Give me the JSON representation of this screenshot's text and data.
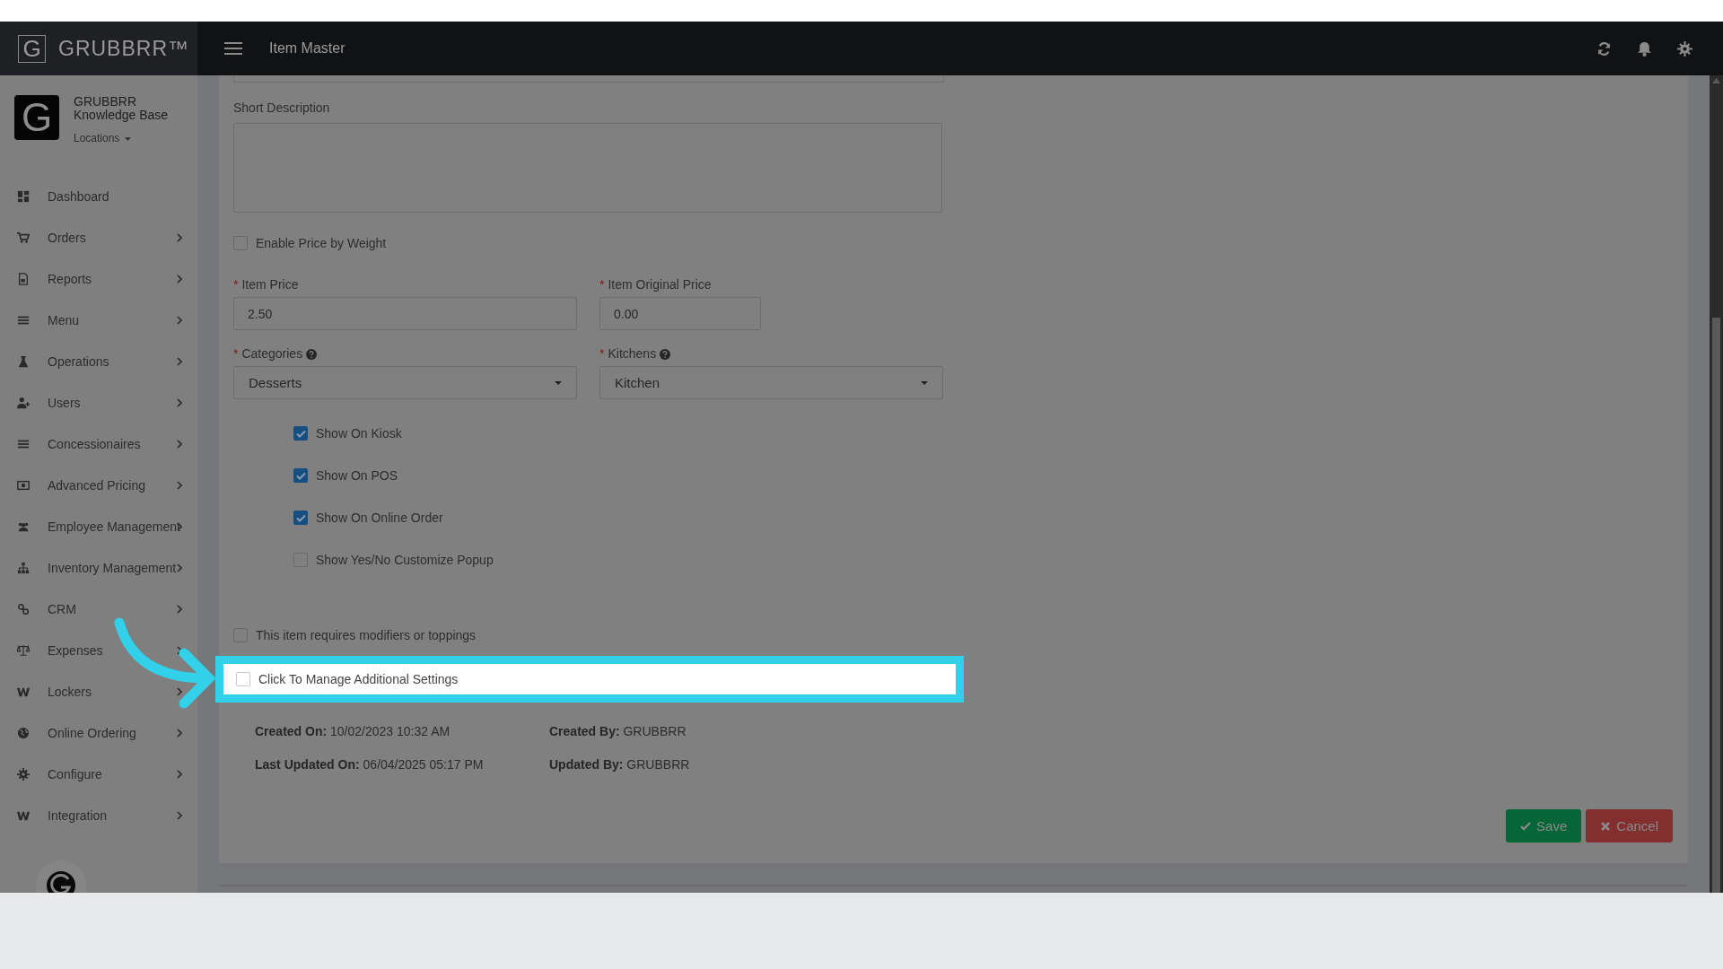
{
  "header": {
    "logo_letter": "G",
    "brand": "GRUBBRR™",
    "title": "Item Master"
  },
  "sidebar": {
    "org_logo_letter": "G",
    "org_name": "GRUBBRR",
    "org_subtitle": "Knowledge Base",
    "locations": "Locations",
    "items": [
      {
        "label": "Dashboard",
        "expandable": false
      },
      {
        "label": "Orders",
        "expandable": true
      },
      {
        "label": "Reports",
        "expandable": true
      },
      {
        "label": "Menu",
        "expandable": true
      },
      {
        "label": "Operations",
        "expandable": true
      },
      {
        "label": "Users",
        "expandable": true
      },
      {
        "label": "Concessionaires",
        "expandable": true
      },
      {
        "label": "Advanced Pricing",
        "expandable": true
      },
      {
        "label": "Employee Management",
        "expandable": true
      },
      {
        "label": "Inventory Management",
        "expandable": true
      },
      {
        "label": "CRM",
        "expandable": true
      },
      {
        "label": "Expenses",
        "expandable": true
      },
      {
        "label": "Lockers",
        "expandable": true
      },
      {
        "label": "Online Ordering",
        "expandable": true
      },
      {
        "label": "Configure",
        "expandable": true
      },
      {
        "label": "Integration",
        "expandable": true
      }
    ]
  },
  "form": {
    "short_description": {
      "label": "Short Description"
    },
    "price_by_weight": {
      "label": "Enable Price by Weight",
      "checked": false
    },
    "item_price": {
      "required_mark": "*",
      "label": "Item Price",
      "value": "2.50"
    },
    "item_original_price": {
      "required_mark": "*",
      "label": "Item Original Price",
      "value": "0.00"
    },
    "categories": {
      "required_mark": "*",
      "label": "Categories",
      "value": "Desserts"
    },
    "kitchens": {
      "required_mark": "*",
      "label": "Kitchens",
      "value": "Kitchen"
    },
    "visibility": [
      {
        "label": "Show On Kiosk",
        "checked": true
      },
      {
        "label": "Show On POS",
        "checked": true
      },
      {
        "label": "Show On Online Order",
        "checked": true
      },
      {
        "label": "Show Yes/No Customize Popup",
        "checked": false
      }
    ],
    "requires_modifiers": {
      "label": "This item requires modifiers or toppings",
      "checked": false
    },
    "additional_settings": {
      "label": "Click To Manage Additional Settings",
      "checked": false,
      "highlighted": true
    },
    "audit": [
      {
        "label": "Created On:",
        "value": "10/02/2023 10:32 AM"
      },
      {
        "label": "Created By:",
        "value": "GRUBBRR"
      },
      {
        "label": "Last Updated On:",
        "value": "06/04/2025 05:17 PM"
      },
      {
        "label": "Updated By:",
        "value": "GRUBBRR"
      }
    ],
    "buttons": [
      {
        "label": "Save",
        "kind": "save"
      },
      {
        "label": "Cancel",
        "kind": "cancel"
      }
    ]
  }
}
